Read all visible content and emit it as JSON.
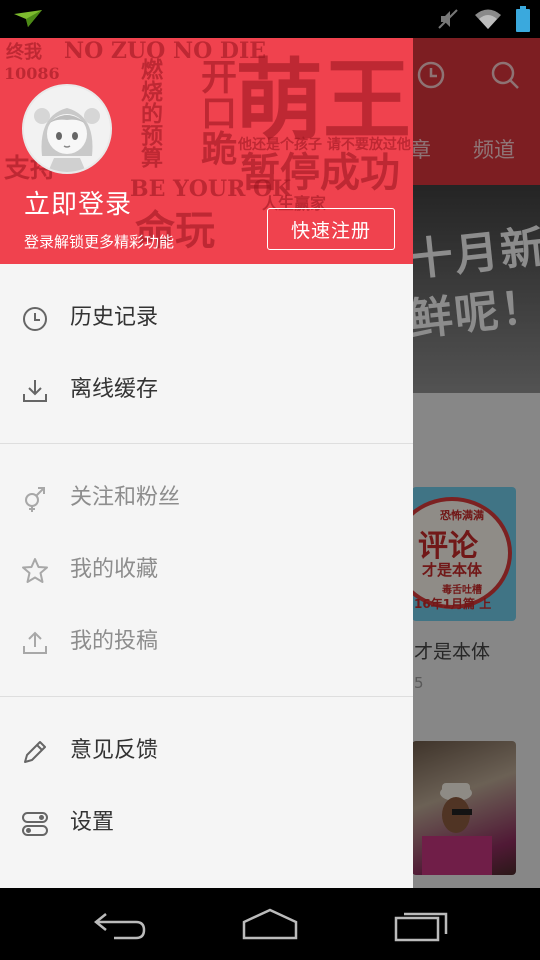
{
  "status_bar": {
    "icons": [
      "paper-plane-notification-icon",
      "mute-icon",
      "wifi-icon",
      "battery-icon"
    ]
  },
  "background": {
    "tabs": [
      "章",
      "频道"
    ],
    "banner_text": [
      "十月新番",
      "鲜呢！"
    ],
    "card": {
      "thumb_lines": [
        "恐怖满满",
        "评论",
        "才是本体",
        "毒舌吐槽",
        "16年1月篇 上"
      ],
      "title": "才是本体",
      "subtitle": "5"
    }
  },
  "drawer": {
    "header": {
      "watermark_lines": [
        "NO ZUO NO DIE",
        "萌王",
        "开口跪",
        "燃烧的预算",
        "暂停成功",
        "他还是个孩子 请不要放过他",
        "BE YOUR OK",
        "人生赢家",
        "命玩",
        "10086",
        "终我",
        "支持"
      ],
      "login_title": "立即登录",
      "login_subtitle": "登录解锁更多精彩功能",
      "register_button": "快速注册"
    },
    "menu_group_1": [
      {
        "label": "历史记录",
        "icon": "clock-icon"
      },
      {
        "label": "离线缓存",
        "icon": "download-icon"
      }
    ],
    "menu_group_2": [
      {
        "label": "关注和粉丝",
        "icon": "gender-icon"
      },
      {
        "label": "我的收藏",
        "icon": "star-icon"
      },
      {
        "label": "我的投稿",
        "icon": "upload-icon"
      }
    ],
    "menu_group_3": [
      {
        "label": "意见反馈",
        "icon": "pencil-icon"
      },
      {
        "label": "设置",
        "icon": "settings-toggle-icon"
      }
    ]
  },
  "nav_bar": {
    "buttons": [
      "back-icon",
      "home-icon",
      "recents-icon"
    ]
  },
  "colors": {
    "drawer_header": "#f0424e",
    "app_topbar": "#d8353c",
    "drawer_bg": "#f5f5f5"
  }
}
